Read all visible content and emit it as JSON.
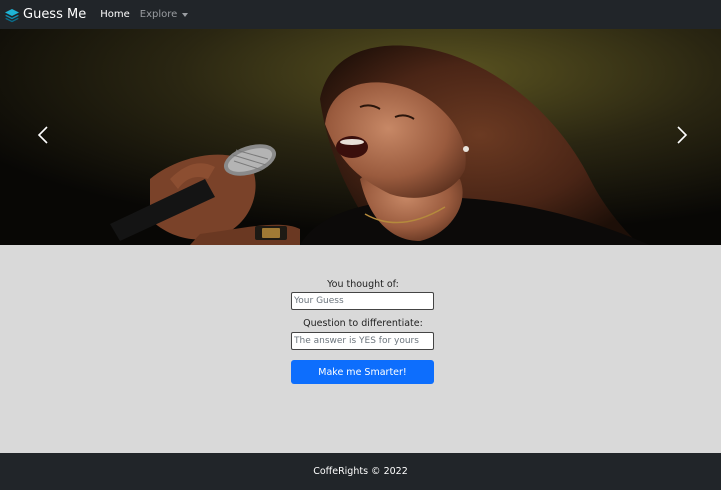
{
  "navbar": {
    "brand": "Guess Me",
    "links": [
      {
        "label": "Home"
      },
      {
        "label": "Explore"
      }
    ]
  },
  "carousel": {
    "prev_icon": "chevron-left-icon",
    "next_icon": "chevron-right-icon"
  },
  "form": {
    "thought_label": "You thought of:",
    "guess_placeholder": "Your Guess",
    "question_label": "Question to differentiate:",
    "question_placeholder": "The answer is YES for yours",
    "submit_label": "Make me Smarter!"
  },
  "footer": {
    "text": "CoffeRights © 2022"
  },
  "colors": {
    "navbar_bg": "#212529",
    "primary": "#0d6efd",
    "body_bg": "#d9d9d9"
  }
}
